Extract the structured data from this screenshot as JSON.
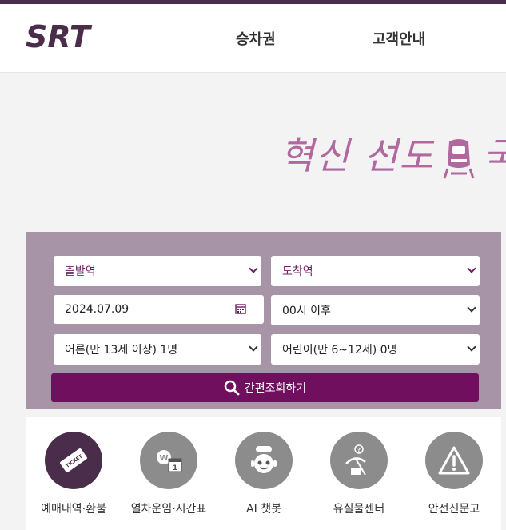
{
  "header": {
    "logo_text": "SRT",
    "nav": [
      "승차권",
      "고객안내"
    ]
  },
  "banner": {
    "text_left": "혁신 선도",
    "text_right": "국"
  },
  "search": {
    "departure": "출발역",
    "arrival": "도착역",
    "date": "2024.07.09",
    "time": "00시 이후",
    "adult": "어른(만 13세 이상) 1명",
    "child": "어린이(만 6~12세) 0명",
    "button": "간편조회하기"
  },
  "quick_menu": [
    {
      "label": "예매내역·환불",
      "icon": "ticket-icon"
    },
    {
      "label": "열차운임·시간표",
      "icon": "fare-timetable-icon"
    },
    {
      "label": "AI 챗봇",
      "icon": "chatbot-icon"
    },
    {
      "label": "유실물센터",
      "icon": "lost-found-icon"
    },
    {
      "label": "안전신문고",
      "icon": "warning-icon"
    }
  ],
  "colors": {
    "brand": "#4a2d4b",
    "button": "#6f0f5d",
    "panel": "#a795a7"
  }
}
